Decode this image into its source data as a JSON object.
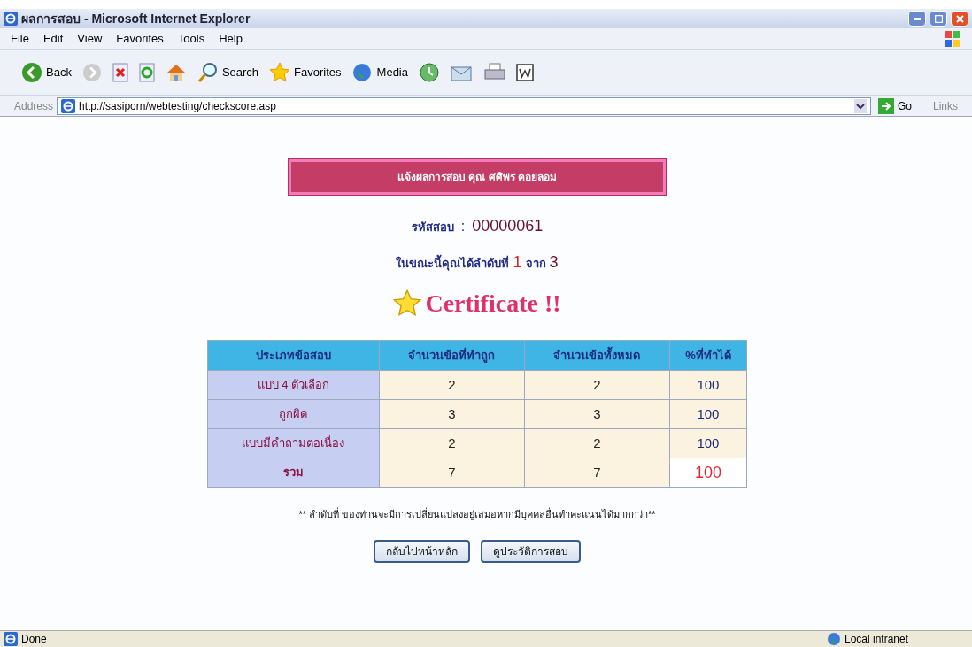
{
  "window": {
    "title": "ผลการสอบ - Microsoft Internet Explorer"
  },
  "menu": [
    "File",
    "Edit",
    "View",
    "Favorites",
    "Tools",
    "Help"
  ],
  "toolbar": [
    {
      "kind": "back",
      "label": "Back"
    },
    {
      "kind": "forward"
    },
    {
      "kind": "stop"
    },
    {
      "kind": "refresh"
    },
    {
      "kind": "home"
    },
    {
      "kind": "search",
      "label": "Search"
    },
    {
      "kind": "favorites",
      "label": "Favorites"
    },
    {
      "kind": "media",
      "label": "Media"
    },
    {
      "kind": "history"
    },
    {
      "kind": "mail"
    },
    {
      "kind": "print"
    },
    {
      "kind": "word"
    }
  ],
  "address": {
    "label": "Address",
    "value": "http://sasiporn/webtesting/checkscore.asp",
    "go": "Go",
    "links": "Links"
  },
  "page": {
    "banner": "แจ้งผลการสอบ คุณ ศศิพร  คอยลอม",
    "exam_code_label": "รหัสสอบ",
    "exam_code_sep": ":",
    "exam_code": "00000061",
    "rank_text": "ในขณะนี้คุณได้ลำดับที่",
    "rank": "1",
    "rank_of": "จาก",
    "rank_total": "3",
    "certificate": "Certificate !!",
    "table": {
      "columns": [
        "ประเภทข้อสอบ",
        "จำนวนข้อที่ทำถูก",
        "จำนวนข้อทั้งหมด",
        "%ที่ทำได้"
      ],
      "rows": [
        {
          "kind": "item",
          "cells": [
            "แบบ 4 ตัวเลือก",
            "2",
            "2",
            "100"
          ]
        },
        {
          "kind": "item",
          "cells": [
            "ถูกผิด",
            "3",
            "3",
            "100"
          ]
        },
        {
          "kind": "item",
          "cells": [
            "แบบมีคำถามต่อเนื่อง",
            "2",
            "2",
            "100"
          ]
        },
        {
          "kind": "total",
          "cells": [
            "รวม",
            "7",
            "7",
            "100"
          ]
        }
      ]
    },
    "note": "** ลำดับที่ ของท่านจะมีการเปลี่ยนแปลงอยู่เสมอหากมีบุคคลอื่นทำคะแนนได้มากกว่า**",
    "buttons": [
      "กลับไปหน้าหลัก",
      "ดูประวัติการสอบ"
    ]
  },
  "status_bar": {
    "left": "Done",
    "right": "Local intranet"
  }
}
